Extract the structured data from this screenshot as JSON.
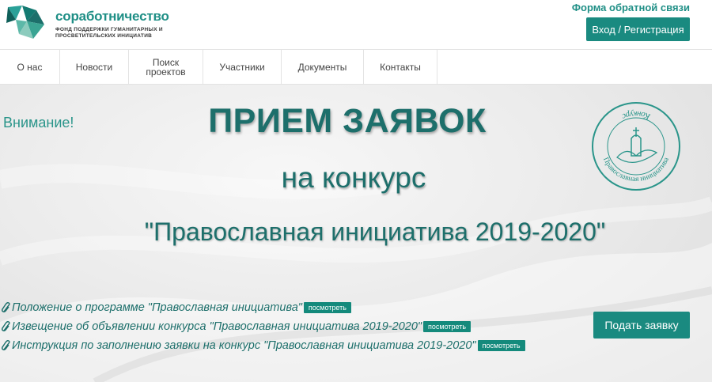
{
  "header": {
    "logo": {
      "name": "соработничество",
      "subtitle_line1": "ФОНД ПОДДЕРЖКИ ГУМАНИТАРНЫХ И",
      "subtitle_line2": "ПРОСВЕТИТЕЛЬСКИХ ИНИЦИАТИВ"
    },
    "feedback_label": "Форма обратной связи",
    "login_label": "Вход / Регистрация"
  },
  "nav": {
    "items": [
      {
        "label": "О нас"
      },
      {
        "label": "Новости"
      },
      {
        "label": "Поиск проектов",
        "line1": "Поиск",
        "line2": "проектов"
      },
      {
        "label": "Участники"
      },
      {
        "label": "Документы"
      },
      {
        "label": "Контакты"
      }
    ]
  },
  "banner": {
    "attention": "Внимание!",
    "title": "ПРИЕМ ЗАЯВОК",
    "subtitle": "на конкурс",
    "contest_name": "\"Православная инициатива 2019-2020\"",
    "seal": {
      "top_text": "Конкурс",
      "ring_text": "Православная инициатива"
    }
  },
  "documents": [
    {
      "text": "Положение о программе \"Православная инициатива\"",
      "action": "посмотреть"
    },
    {
      "text": "Извещение об объявлении конкурса \"Православная инициатива 2019-2020\"",
      "action": "посмотреть"
    },
    {
      "text": "Инструкция по заполнению заявки на конкурс \"Православная инициатива 2019-2020\"",
      "action": "посмотреть"
    }
  ],
  "apply_label": "Подать заявку",
  "colors": {
    "brand": "#1a8a80",
    "heading": "#1d6f6b",
    "accent_text": "#2a958a"
  }
}
